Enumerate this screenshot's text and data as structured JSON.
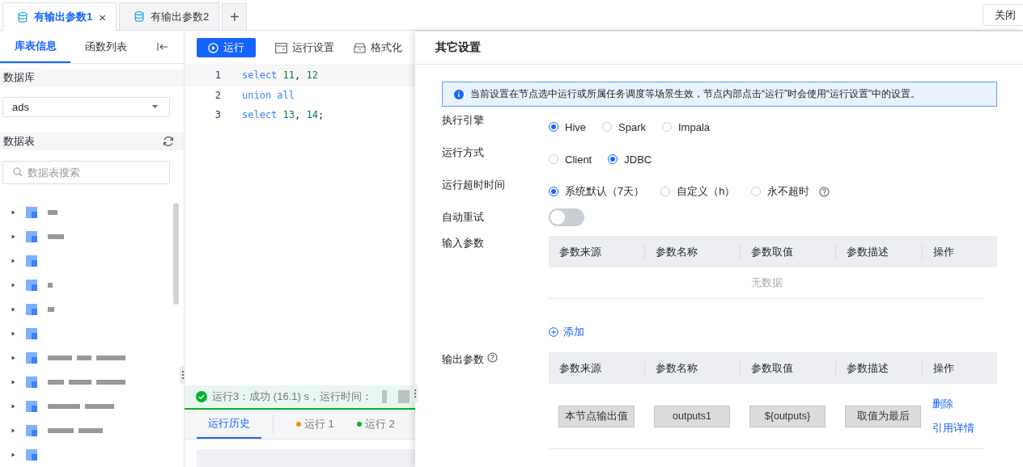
{
  "file_tabs": [
    {
      "label": "有输出参数1",
      "selected": true,
      "close_icon": "×"
    },
    {
      "label": "有输出参数2",
      "selected": false
    }
  ],
  "add_tab": "+",
  "close_button": "关闭",
  "sidebar": {
    "tabs": [
      {
        "label": "库表信息",
        "selected": true
      },
      {
        "label": "函数列表",
        "selected": false
      }
    ],
    "database": {
      "title": "数据库",
      "value": "ads"
    },
    "tables": {
      "title": "数据表",
      "placeholder": "数据表搜索"
    },
    "tree": [
      {
        "expanded": false
      },
      {
        "expanded": false
      },
      {
        "expanded": false
      },
      {
        "expanded": false
      },
      {
        "expanded": false
      },
      {
        "expanded": false
      },
      {
        "expanded": false
      },
      {
        "expanded": false
      },
      {
        "expanded": false
      },
      {
        "expanded": false
      },
      {
        "expanded": false
      }
    ]
  },
  "editor": {
    "toolbar": [
      {
        "label": "运行",
        "kind": "primary"
      },
      {
        "label": "运行设置",
        "kind": "settings"
      },
      {
        "label": "格式化",
        "kind": "format"
      }
    ],
    "code_lines": [
      {
        "number": "1",
        "tokens": [
          {
            "text": "select ",
            "kind": "keyword"
          },
          {
            "text": "11",
            "kind": "number"
          },
          {
            "text": ", ",
            "kind": "plain"
          },
          {
            "text": "12",
            "kind": "number"
          }
        ]
      },
      {
        "number": "2",
        "tokens": [
          {
            "text": "union all",
            "kind": "keyword"
          }
        ]
      },
      {
        "number": "3",
        "tokens": [
          {
            "text": "select ",
            "kind": "keyword"
          },
          {
            "text": "13",
            "kind": "number"
          },
          {
            "text": ", ",
            "kind": "plain"
          },
          {
            "text": "14",
            "kind": "number"
          },
          {
            "text": ";",
            "kind": "plain"
          }
        ]
      }
    ],
    "status": {
      "text": "运行3：成功 (16.1) s，运行时间："
    },
    "result_tabs": [
      {
        "label": "运行历史",
        "selected": true
      },
      {
        "label": "运行 1",
        "selected": false,
        "color": "#fa8c16"
      },
      {
        "label": "运行 2",
        "selected": false,
        "color": "#00b42a"
      }
    ]
  },
  "drawer": {
    "title": "其它设置",
    "notice": "当前设置在节点选中运行或所属任务调度等场景生效，节点内部点击“运行”时会使用“运行设置”中的设置。",
    "fields": [
      {
        "label": "执行引擎",
        "kind": "radio",
        "help": false,
        "options": [
          {
            "label": "Hive",
            "selected": true
          },
          {
            "label": "Spark",
            "selected": false
          },
          {
            "label": "Impala",
            "selected": false
          }
        ]
      },
      {
        "label": "运行方式",
        "kind": "radio",
        "help": false,
        "options": [
          {
            "label": "Client",
            "selected": false
          },
          {
            "label": "JDBC",
            "selected": true
          }
        ]
      },
      {
        "label": "运行超时时间",
        "kind": "radio",
        "help": true,
        "options": [
          {
            "label": "系统默认（7天）",
            "selected": true
          },
          {
            "label": "自定义（h）",
            "selected": false
          },
          {
            "label": "永不超时",
            "selected": false
          }
        ]
      },
      {
        "label": "自动重试",
        "kind": "switch",
        "help": false,
        "on": false
      },
      {
        "label": "输入参数",
        "kind": "table",
        "help": false,
        "columns": [
          "参数来源",
          "参数名称",
          "参数取值",
          "参数描述",
          "操作"
        ],
        "empty": "无数据",
        "add": "添加"
      },
      {
        "label": "输出参数",
        "kind": "table",
        "help": true,
        "columns": [
          "参数来源",
          "参数名称",
          "参数取值",
          "参数描述",
          "操作"
        ],
        "rows": [
          {
            "cells": [
              "本节点输出值",
              "outputs1",
              "${outputs}",
              "取值为最后"
            ],
            "actions": [
              "删除",
              "引用详情"
            ]
          }
        ]
      }
    ]
  }
}
